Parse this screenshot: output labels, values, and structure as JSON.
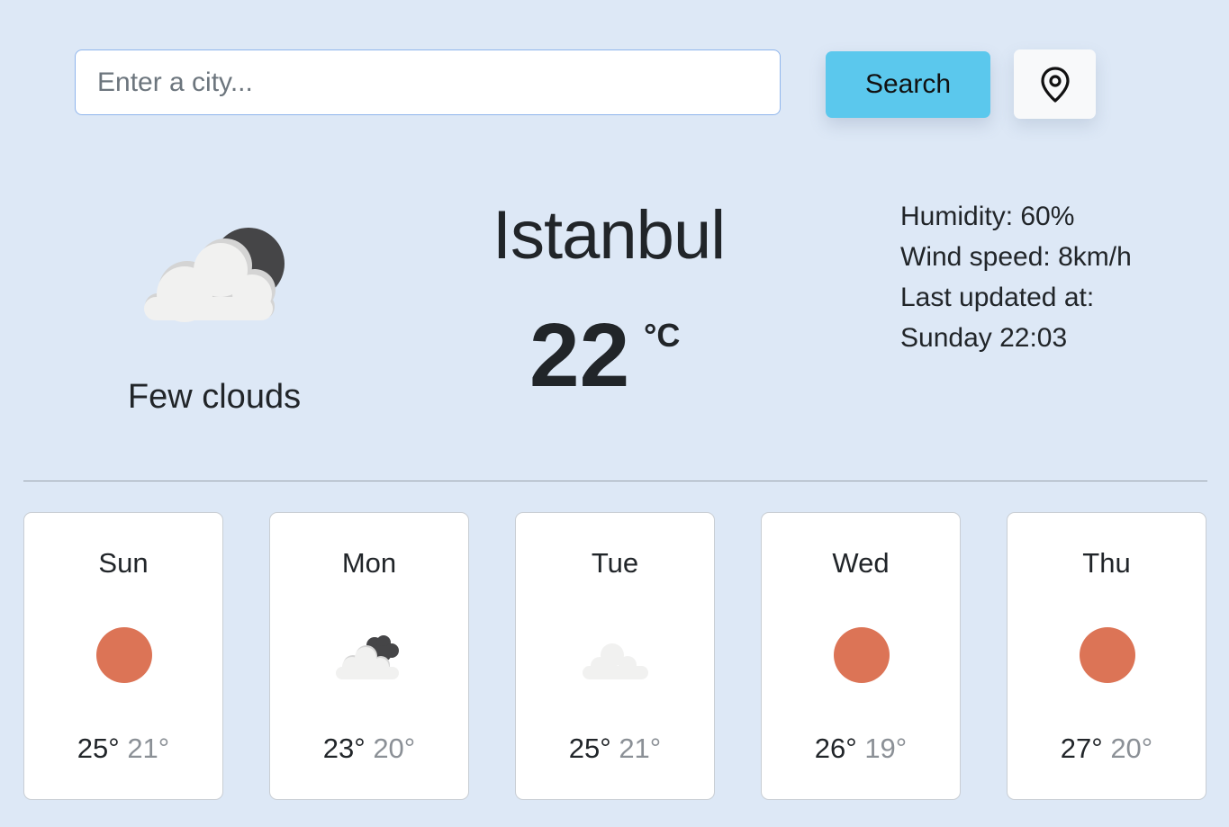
{
  "search": {
    "placeholder": "Enter a city...",
    "value": "",
    "button_label": "Search"
  },
  "location_button": {
    "icon": "map-pin-icon"
  },
  "current": {
    "icon": "few-clouds-night-icon",
    "description": "Few clouds",
    "city": "Istanbul",
    "temperature": "22",
    "unit": "°C",
    "humidity": "Humidity: 60%",
    "wind": "Wind speed: 8km/h",
    "updated_label": "Last updated at:",
    "updated_value": "Sunday 22:03"
  },
  "forecast": [
    {
      "day": "Sun",
      "icon": "clear-sun-icon",
      "max": "25°",
      "min": "21°"
    },
    {
      "day": "Mon",
      "icon": "broken-clouds-icon",
      "max": "23°",
      "min": "20°"
    },
    {
      "day": "Tue",
      "icon": "cloud-icon",
      "max": "25°",
      "min": "21°"
    },
    {
      "day": "Wed",
      "icon": "clear-sun-icon",
      "max": "26°",
      "min": "19°"
    },
    {
      "day": "Thu",
      "icon": "clear-sun-icon",
      "max": "27°",
      "min": "20°"
    }
  ],
  "colors": {
    "background": "#dde8f6",
    "search_button": "#5bc8ed",
    "sun": "#dc7456",
    "cloud": "#f0f0f0",
    "dark_cloud": "#454547",
    "min_temp": "#8b9096"
  }
}
